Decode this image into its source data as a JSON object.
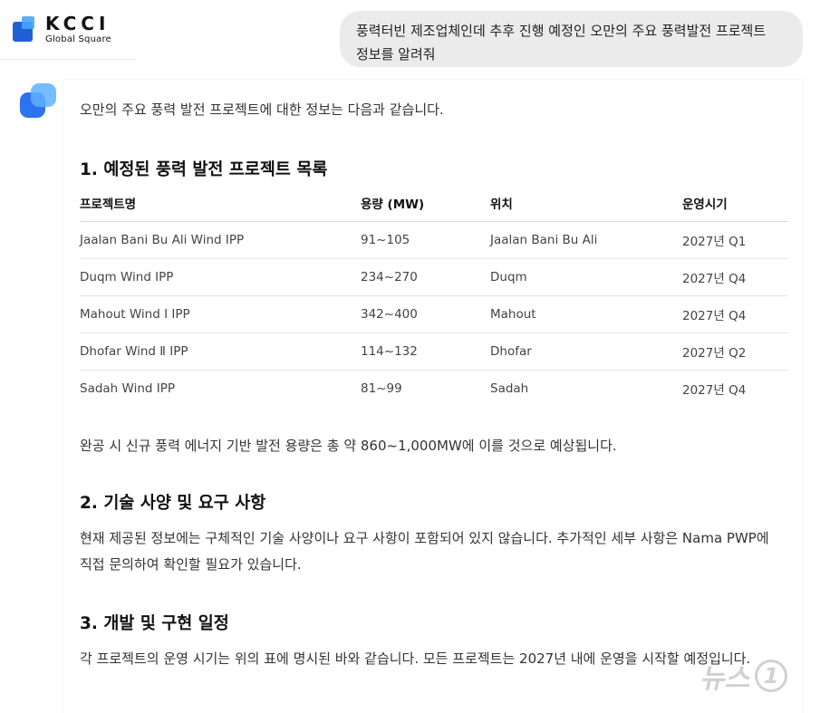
{
  "logo": {
    "main": "KCCI",
    "sub": "Global Square"
  },
  "user_message": "풍력터빈 제조업체인데 추후 진행 예정인 오만의 주요 풍력발전 프로젝트 정보를 알려줘",
  "answer": {
    "intro": "오만의 주요 풍력 발전 프로젝트에 대한 정보는 다음과 같습니다.",
    "section1_title": "1. 예정된 풍력 발전 프로젝트 목록",
    "table": {
      "headers": [
        "프로젝트명",
        "용량 (MW)",
        "위치",
        "운영시기"
      ],
      "rows": [
        [
          "Jaalan Bani Bu Ali Wind IPP",
          "91~105",
          "Jaalan Bani Bu Ali",
          "2027년 Q1"
        ],
        [
          "Duqm Wind IPP",
          "234~270",
          "Duqm",
          "2027년 Q4"
        ],
        [
          "Mahout Wind Ⅰ IPP",
          "342~400",
          "Mahout",
          "2027년 Q4"
        ],
        [
          "Dhofar Wind Ⅱ IPP",
          "114~132",
          "Dhofar",
          "2027년 Q2"
        ],
        [
          "Sadah Wind IPP",
          "81~99",
          "Sadah",
          "2027년 Q4"
        ]
      ]
    },
    "section1_summary": "완공 시 신규 풍력 에너지 기반 발전 용량은 총 약 860~1,000MW에 이를 것으로 예상됩니다.",
    "section2_title": "2. 기술 사양 및 요구 사항",
    "section2_text": "현재 제공된 정보에는 구체적인 기술 사양이나 요구 사항이 포함되어 있지 않습니다. 추가적인 세부 사항은 Nama PWP에 직접 문의하여 확인할 필요가 있습니다.",
    "section3_title": "3. 개발 및 구현 일정",
    "section3_text": "각 프로젝트의 운영 시기는 위의 표에 명시된 바와 같습니다. 모든 프로젝트는 2027년 내에 운영을 시작할 예정입니다."
  },
  "watermark": {
    "text": "뉴스",
    "number": "1"
  },
  "colors": {
    "brand_blue": "#1f5fd6",
    "bubble_bg": "#ebebeb"
  }
}
